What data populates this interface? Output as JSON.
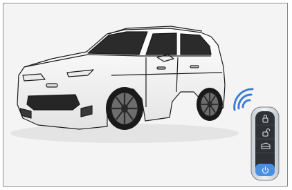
{
  "illustration": {
    "subject": "car-with-smart-key",
    "colors": {
      "background": "#f4f4f4",
      "frame_border": "#8a8a8a",
      "car_body": "#fbfbfb",
      "car_outline": "#1c1c1c",
      "glass": "#2b2b2b",
      "tire": "#1a1a1a",
      "signal": "#3a7fd5",
      "key_body": "#d9dde2",
      "key_active_button": "#4a90e2"
    },
    "key_fob": {
      "buttons": [
        {
          "icon": "lock-icon",
          "highlighted": false
        },
        {
          "icon": "unlock-icon",
          "highlighted": false
        },
        {
          "icon": "trunk-icon",
          "highlighted": false
        },
        {
          "icon": "remote-start-icon",
          "highlighted": true
        }
      ]
    },
    "signal_waves": 3
  }
}
